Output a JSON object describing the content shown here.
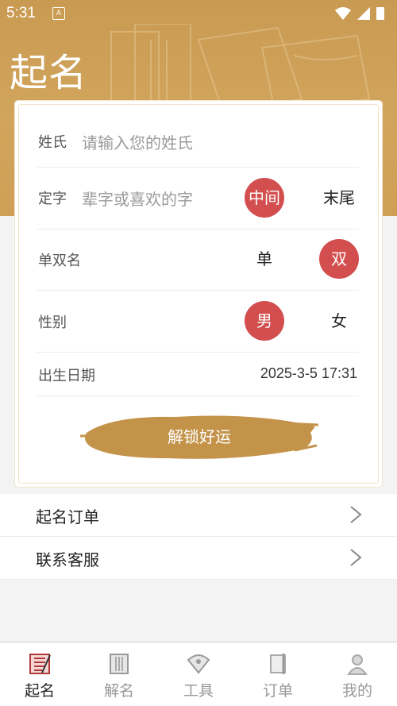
{
  "status_bar": {
    "time": "5:31"
  },
  "header": {
    "title": "起名"
  },
  "form": {
    "surname": {
      "label": "姓氏",
      "placeholder": "请输入您的姓氏"
    },
    "fixed_char": {
      "label": "定字",
      "placeholder": "辈字或喜欢的字",
      "options": [
        "中间",
        "末尾"
      ],
      "selected": "中间"
    },
    "name_length": {
      "label": "单双名",
      "options": [
        "单",
        "双"
      ],
      "selected": "双"
    },
    "gender": {
      "label": "性别",
      "options": [
        "男",
        "女"
      ],
      "selected": "男"
    },
    "birth": {
      "label": "出生日期",
      "value": "2025-3-5 17:31"
    },
    "submit_label": "解锁好运"
  },
  "menu": [
    {
      "label": "起名订单"
    },
    {
      "label": "联系客服"
    }
  ],
  "tabs": [
    {
      "label": "起名",
      "icon": "naming-icon",
      "active": true
    },
    {
      "label": "解名",
      "icon": "book-icon",
      "active": false
    },
    {
      "label": "工具",
      "icon": "fan-icon",
      "active": false
    },
    {
      "label": "订单",
      "icon": "scroll-icon",
      "active": false
    },
    {
      "label": "我的",
      "icon": "profile-icon",
      "active": false
    }
  ],
  "colors": {
    "header_gold": "#cf9f55",
    "accent_red": "#d34e4e",
    "brush_gold": "#c4934a"
  }
}
